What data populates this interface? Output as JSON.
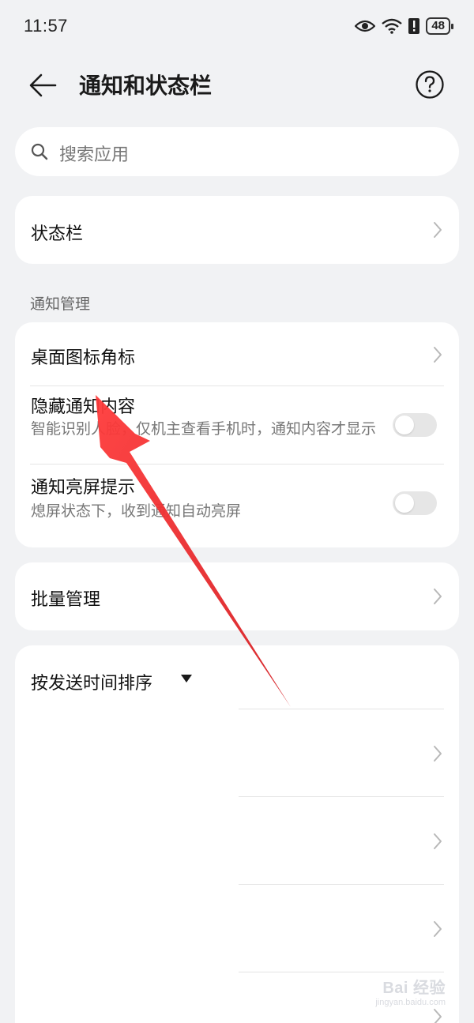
{
  "status_bar": {
    "time": "11:57",
    "battery": "48",
    "icons": [
      "eye-icon",
      "wifi-icon",
      "alert-icon",
      "battery-icon"
    ]
  },
  "header": {
    "title": "通知和状态栏",
    "back_icon": "back-arrow-icon",
    "help_icon": "help-icon"
  },
  "search": {
    "placeholder": "搜索应用"
  },
  "status_bar_entry": {
    "label": "状态栏"
  },
  "notification_section": {
    "label": "通知管理",
    "items": [
      {
        "label": "桌面图标角标"
      },
      {
        "label": "隐藏通知内容",
        "description": "智能识别人脸，仅机主查看手机时，通知内容才显示",
        "toggle_on": false
      },
      {
        "label": "通知亮屏提示",
        "description": "熄屏状态下，收到通知自动亮屏",
        "toggle_on": false
      }
    ]
  },
  "batch_manage": {
    "label": "批量管理"
  },
  "sort": {
    "label": "按发送时间排序"
  },
  "watermark": {
    "main": "Bai 经验",
    "sub": "jingyan.baidu.com"
  },
  "colors": {
    "background": "#f1f2f4",
    "card": "#ffffff",
    "annotation_arrow": "#e8262b",
    "toggle_off": "#e6e6e6"
  }
}
